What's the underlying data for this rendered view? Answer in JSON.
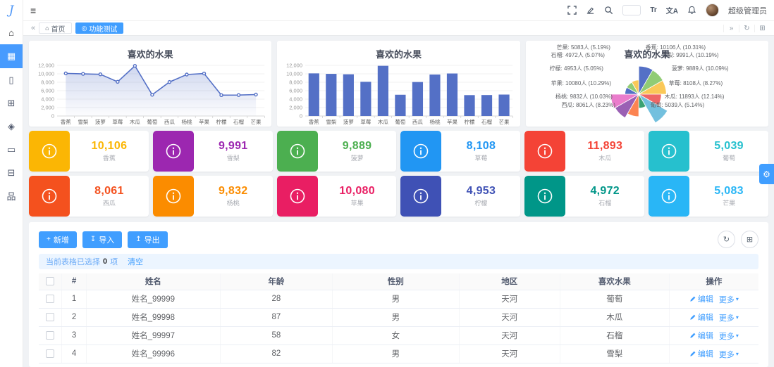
{
  "app": {
    "logo_letter": "J",
    "username": "超级管理员"
  },
  "topbar": {
    "font_size_icon_text": "Tr",
    "translate_icon_text": "文A"
  },
  "icons": {
    "hamburger": "≡",
    "collapse-left": "«",
    "collapse-right": "»",
    "refresh": "↻",
    "grid": "⊞",
    "home": "⌂",
    "tab-active": "◎",
    "plus": "+",
    "import-arrow": "↧",
    "export-arrow": "↥",
    "gear": "⚙",
    "caret-down": "▾"
  },
  "tabbar": {
    "tabs": [
      {
        "label": "首页",
        "active": false
      },
      {
        "label": "功能测试",
        "active": true
      }
    ]
  },
  "sidebar": {
    "items": [
      {
        "name": "home-icon",
        "glyph": "⌂",
        "active": false
      },
      {
        "name": "layout-icon",
        "glyph": "▦",
        "active": true
      },
      {
        "name": "mobile-icon",
        "glyph": "▯",
        "active": false
      },
      {
        "name": "apps-icon",
        "glyph": "⊞",
        "active": false
      },
      {
        "name": "components-icon",
        "glyph": "◈",
        "active": false
      },
      {
        "name": "card-icon",
        "glyph": "▭",
        "active": false
      },
      {
        "name": "pages-icon",
        "glyph": "⊟",
        "active": false
      },
      {
        "name": "sitemap-icon",
        "glyph": "品",
        "active": false
      }
    ]
  },
  "chart_data": [
    {
      "type": "line",
      "title": "喜欢的水果",
      "categories": [
        "香蕉",
        "雪梨",
        "菠萝",
        "草莓",
        "木瓜",
        "葡萄",
        "西瓜",
        "杨桃",
        "苹果",
        "柠檬",
        "石榴",
        "芒果"
      ],
      "values": [
        10106,
        9991,
        9889,
        8108,
        11893,
        5039,
        8061,
        9832,
        10080,
        4953,
        4972,
        5083
      ],
      "ylim": [
        0,
        12000
      ],
      "ytick_step": 2000,
      "color": "#5470c6",
      "area": true,
      "grid": true
    },
    {
      "type": "bar",
      "title": "喜欢的水果",
      "categories": [
        "香蕉",
        "雪梨",
        "菠萝",
        "草莓",
        "木瓜",
        "葡萄",
        "西瓜",
        "杨桃",
        "苹果",
        "柠檬",
        "石榴",
        "芒果"
      ],
      "values": [
        10106,
        9991,
        9889,
        8108,
        11893,
        5039,
        8061,
        9832,
        10080,
        4953,
        4972,
        5083
      ],
      "ylim": [
        0,
        12000
      ],
      "ytick_step": 2000,
      "color": "#5470c6",
      "grid": true
    },
    {
      "type": "pie",
      "subtype": "rose",
      "title": "喜欢的水果",
      "label_unit": "人",
      "series": [
        {
          "name": "香蕉",
          "value": 10106,
          "percent": "10.31%"
        },
        {
          "name": "雪梨",
          "value": 9991,
          "percent": "10.19%"
        },
        {
          "name": "菠萝",
          "value": 9889,
          "percent": "10.09%"
        },
        {
          "name": "草莓",
          "value": 8108,
          "percent": "8.27%"
        },
        {
          "name": "木瓜",
          "value": 11893,
          "percent": "12.14%"
        },
        {
          "name": "葡萄",
          "value": 5039,
          "percent": "5.14%"
        },
        {
          "name": "西瓜",
          "value": 8061,
          "percent": "8.23%"
        },
        {
          "name": "杨桃",
          "value": 9832,
          "percent": "10.03%"
        },
        {
          "name": "苹果",
          "value": 10080,
          "percent": "10.29%"
        },
        {
          "name": "柠檬",
          "value": 4953,
          "percent": "5.05%"
        },
        {
          "name": "石榴",
          "value": 4972,
          "percent": "5.07%"
        },
        {
          "name": "芒果",
          "value": 5083,
          "percent": "5.19%"
        }
      ],
      "colors": [
        "#5470c6",
        "#91cc75",
        "#fac858",
        "#ee6666",
        "#73c0de",
        "#3ba272",
        "#fc8452",
        "#9a60b4",
        "#ea7ccc",
        "#5470c6",
        "#91cc75",
        "#fac858"
      ]
    }
  ],
  "stat_cards": [
    {
      "value": "10,106",
      "label": "香蕉",
      "color": "#fbb604"
    },
    {
      "value": "9,991",
      "label": "雪梨",
      "color": "#9c27b0"
    },
    {
      "value": "9,889",
      "label": "菠萝",
      "color": "#4caf50"
    },
    {
      "value": "8,108",
      "label": "草莓",
      "color": "#2196f3"
    },
    {
      "value": "11,893",
      "label": "木瓜",
      "color": "#f44336"
    },
    {
      "value": "5,039",
      "label": "葡萄",
      "color": "#26c0ce"
    },
    {
      "value": "8,061",
      "label": "西瓜",
      "color": "#f4511e"
    },
    {
      "value": "9,832",
      "label": "杨桃",
      "color": "#fb8c00"
    },
    {
      "value": "10,080",
      "label": "苹果",
      "color": "#e91e63"
    },
    {
      "value": "4,953",
      "label": "柠檬",
      "color": "#3f51b5"
    },
    {
      "value": "4,972",
      "label": "石榴",
      "color": "#009688"
    },
    {
      "value": "5,083",
      "label": "芒果",
      "color": "#29b6f6"
    }
  ],
  "toolbar": {
    "add_label": "新增",
    "import_label": "导入",
    "export_label": "导出"
  },
  "selection_bar": {
    "prefix": "当前表格已选择",
    "count": "0",
    "unit": "项",
    "clear_label": "清空"
  },
  "table": {
    "headers": [
      "#",
      "姓名",
      "年龄",
      "性别",
      "地区",
      "喜欢水果",
      "操作"
    ],
    "rows": [
      {
        "index": "1",
        "name": "姓名_99999",
        "age": "28",
        "gender": "男",
        "region": "天河",
        "fruit": "葡萄"
      },
      {
        "index": "2",
        "name": "姓名_99998",
        "age": "87",
        "gender": "男",
        "region": "天河",
        "fruit": "木瓜"
      },
      {
        "index": "3",
        "name": "姓名_99997",
        "age": "58",
        "gender": "女",
        "region": "天河",
        "fruit": "石榴"
      },
      {
        "index": "4",
        "name": "姓名_99996",
        "age": "82",
        "gender": "男",
        "region": "天河",
        "fruit": "雪梨"
      }
    ],
    "edit_label": "编辑",
    "more_label": "更多"
  },
  "colors": {
    "primary": "#409eff",
    "content_bg": "#f0f2f5"
  }
}
